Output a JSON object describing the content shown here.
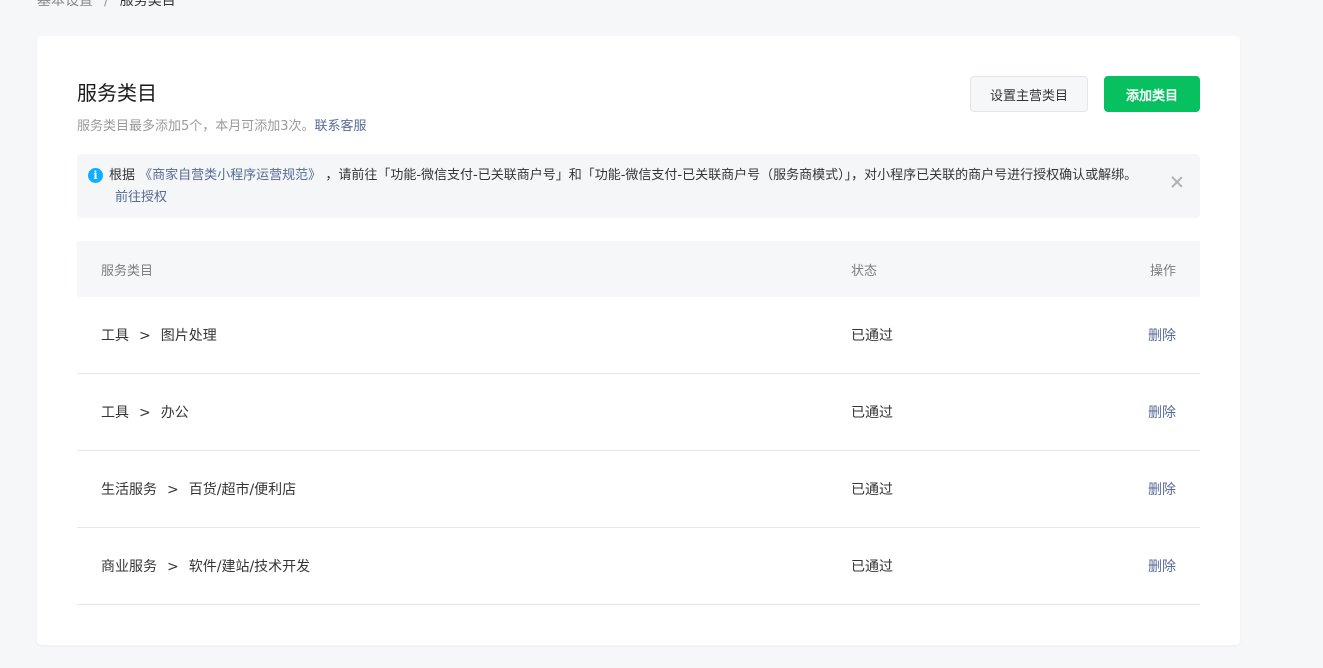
{
  "breadcrumb": {
    "parent": "基本设置",
    "separator": "/",
    "current": "服务类目"
  },
  "header": {
    "title": "服务类目",
    "description": "服务类目最多添加5个，本月可添加3次。",
    "contact_link": "联系客服",
    "btn_set_main": "设置主营类目",
    "btn_add": "添加类目"
  },
  "notice": {
    "icon": "i",
    "text_before": "根据",
    "link_rules": "《商家自营类小程序运营规范》",
    "text_after": "，请前往「功能-微信支付-已关联商户号」和「功能-微信支付-已关联商户号（服务商模式）」，对小程序已关联的商户号进行授权确认或解绑。",
    "link_auth": "前往授权"
  },
  "table": {
    "headers": {
      "category": "服务类目",
      "status": "状态",
      "action": "操作"
    },
    "arrow": ">",
    "rows": [
      {
        "level1": "工具",
        "level2": "图片处理",
        "status": "已通过",
        "action": "删除"
      },
      {
        "level1": "工具",
        "level2": "办公",
        "status": "已通过",
        "action": "删除"
      },
      {
        "level1": "生活服务",
        "level2": "百货/超市/便利店",
        "status": "已通过",
        "action": "删除"
      },
      {
        "level1": "商业服务",
        "level2": "软件/建站/技术开发",
        "status": "已通过",
        "action": "删除"
      }
    ]
  },
  "colors": {
    "primary": "#07c160",
    "link": "#576b95",
    "info": "#10aeff"
  }
}
